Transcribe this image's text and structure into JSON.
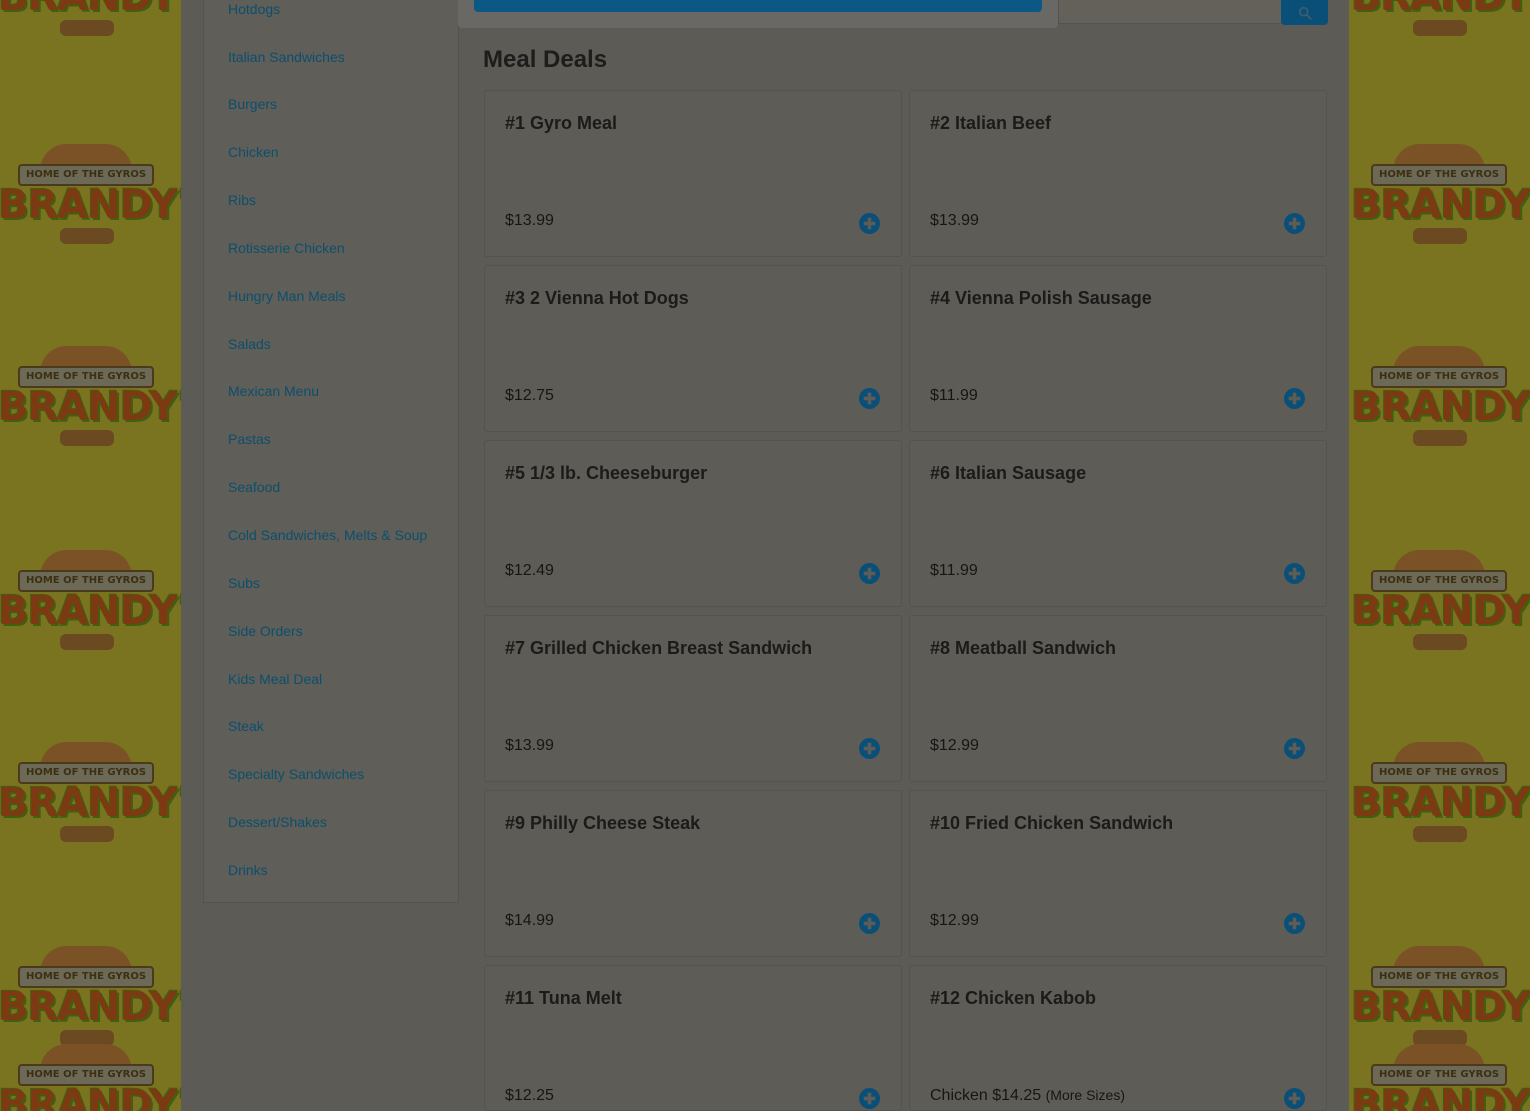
{
  "sidebar": {
    "items": [
      {
        "label": "Hotdogs"
      },
      {
        "label": "Italian Sandwiches"
      },
      {
        "label": "Burgers"
      },
      {
        "label": "Chicken"
      },
      {
        "label": "Ribs"
      },
      {
        "label": "Rotisserie Chicken"
      },
      {
        "label": "Hungry Man Meals"
      },
      {
        "label": "Salads"
      },
      {
        "label": "Mexican Menu"
      },
      {
        "label": "Pastas"
      },
      {
        "label": "Seafood"
      },
      {
        "label": "Cold Sandwiches, Melts & Soup"
      },
      {
        "label": "Subs"
      },
      {
        "label": "Side Orders"
      },
      {
        "label": "Kids Meal Deal"
      },
      {
        "label": "Steak"
      },
      {
        "label": "Specialty Sandwiches"
      },
      {
        "label": "Dessert/Shakes"
      },
      {
        "label": "Drinks"
      }
    ]
  },
  "main": {
    "section_title": "Meal Deals",
    "items": [
      {
        "title": "#1 Gyro Meal",
        "price": "$13.99"
      },
      {
        "title": "#2 Italian Beef",
        "price": "$13.99"
      },
      {
        "title": "#3 2 Vienna Hot Dogs",
        "price": "$12.75"
      },
      {
        "title": "#4 Vienna Polish Sausage",
        "price": "$11.99"
      },
      {
        "title": "#5 1/3 lb. Cheeseburger",
        "price": "$12.49"
      },
      {
        "title": "#6 Italian Sausage",
        "price": "$11.99"
      },
      {
        "title": "#7 Grilled Chicken Breast Sandwich",
        "price": "$13.99"
      },
      {
        "title": "#8 Meatball Sandwich",
        "price": "$12.99"
      },
      {
        "title": "#9 Philly Cheese Steak",
        "price": "$14.99"
      },
      {
        "title": "#10 Fried Chicken Sandwich",
        "price": "$12.99"
      },
      {
        "title": "#11 Tuna Melt",
        "price": "$12.25"
      },
      {
        "title": "#12 Chicken Kabob",
        "price": "Chicken $14.25",
        "more_sizes": "(More Sizes)"
      }
    ]
  },
  "background": {
    "logo_ribbon": "HOME OF THE GYROS",
    "logo_word": "BRANDY'S"
  },
  "colors": {
    "link": "#0b4f6e",
    "add_icon": "#0a4f78",
    "overlay_bg": "#5d5b56"
  },
  "icons": {
    "search": "search-icon",
    "add": "plus-circle-icon"
  }
}
